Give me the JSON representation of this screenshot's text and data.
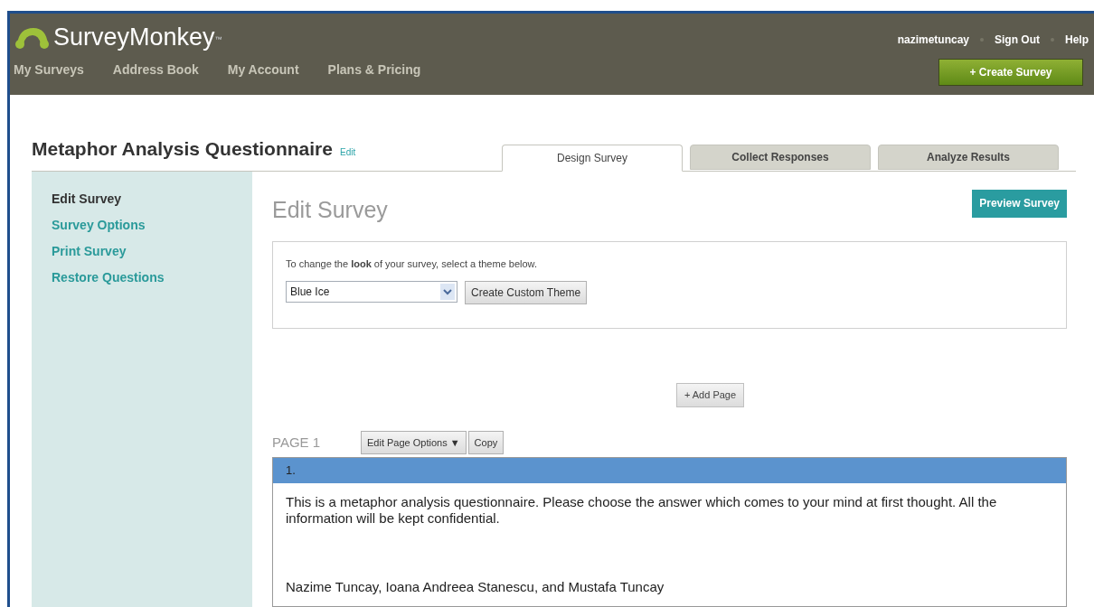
{
  "header": {
    "logo": "SurveyMonkey",
    "trademark": "™",
    "nav": [
      "My Surveys",
      "Address Book",
      "My Account",
      "Plans & Pricing"
    ],
    "user_links": [
      "nazimetuncay",
      "Sign Out",
      "Help"
    ],
    "create_button": "+ Create Survey"
  },
  "survey": {
    "title": "Metaphor Analysis Questionnaire",
    "edit_link": "Edit"
  },
  "tabs": [
    {
      "label": "Design Survey",
      "selected": true
    },
    {
      "label": "Collect Responses",
      "selected": false
    },
    {
      "label": "Analyze Results",
      "selected": false
    }
  ],
  "sidebar": {
    "items": [
      {
        "label": "Edit Survey",
        "selected": true
      },
      {
        "label": "Survey Options",
        "selected": false
      },
      {
        "label": "Print Survey",
        "selected": false
      },
      {
        "label": "Restore Questions",
        "selected": false
      }
    ]
  },
  "main": {
    "heading": "Edit Survey",
    "preview_button": "Preview Survey",
    "theme": {
      "instruction": "To change the **look** of your survey, select a theme below.",
      "value": "Blue Ice",
      "custom_button": "Create Custom Theme"
    },
    "add_page_button": "+ Add Page",
    "page": {
      "label": "PAGE 1",
      "options_button": "Edit Page Options ▼",
      "copy_button": "Copy",
      "question": {
        "number": "1.",
        "text": "This is a metaphor analysis questionnaire. Please choose the answer which comes to your mind at first thought. All the information will be kept confidential.",
        "authors": "Nazime Tuncay, Ioana Andreea Stanescu, and Mustafa Tuncay"
      }
    }
  }
}
